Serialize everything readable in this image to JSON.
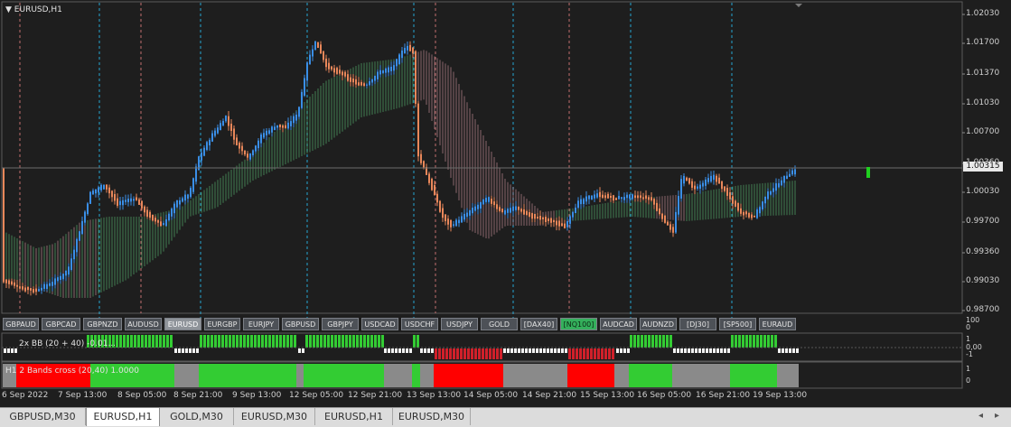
{
  "window": {
    "title": "EURUSD,H1",
    "corner_arrow": "▼"
  },
  "price_axis": {
    "labels": [
      "1.02030",
      "1.01700",
      "1.01370",
      "1.01030",
      "1.00700",
      "1.00360",
      "1.00030",
      "0.99700",
      "0.99360",
      "0.99030",
      "0.98700"
    ],
    "current_price": "1.00315"
  },
  "time_axis": {
    "labels": [
      "6 Sep 2022",
      "7 Sep 13:00",
      "8 Sep 05:00",
      "8 Sep 21:00",
      "9 Sep 13:00",
      "12 Sep 05:00",
      "12 Sep 21:00",
      "13 Sep 13:00",
      "14 Sep 05:00",
      "14 Sep 21:00",
      "15 Sep 13:00",
      "16 Sep 05:00",
      "16 Sep 21:00",
      "19 Sep 13:00"
    ]
  },
  "symbol_bar": {
    "buttons": [
      "GBPAUD",
      "GBPCAD",
      "GBPNZD",
      "AUDUSD",
      "EURUSD",
      "EURGBP",
      "EURJPY",
      "GBPUSD",
      "GBPJPY",
      "USDCAD",
      "USDCHF",
      "USDJPY",
      "GOLD",
      "[DAX40]",
      "[NQ100]",
      "AUDCAD",
      "AUDNZD",
      "[DJ30]",
      "[SP500]",
      "EURAUD"
    ],
    "active": "EURUSD",
    "highlighted": "[NQ100]",
    "scale_top": "100",
    "scale_bottom": "0"
  },
  "indicator1": {
    "title": "2x BB  (20 + 40) -0.01...",
    "scale": [
      "1",
      "0,00",
      "-1"
    ]
  },
  "indicator2": {
    "title": "H1 2 Bands cross (20,40) 1.0000",
    "scale": [
      "1",
      "0"
    ]
  },
  "tabs": [
    "GBPUSD,M30",
    "EURUSD,H1",
    "GOLD,M30",
    "EURUSD,M30",
    "EURUSD,H1",
    "EURUSD,M30"
  ],
  "active_tab_index": 1,
  "colors": {
    "background": "#1e1e1e",
    "bull": "#3a8ee6",
    "bear": "#e8875a",
    "cloud_green": "#5fcf7f",
    "cloud_pink": "#e3a1ad",
    "state_green": "#33cc33",
    "state_red": "#ff0000",
    "state_grey": "#8a8a8a",
    "cyan_grid": "#29b6e5",
    "pink_grid": "#e07d7d"
  }
}
